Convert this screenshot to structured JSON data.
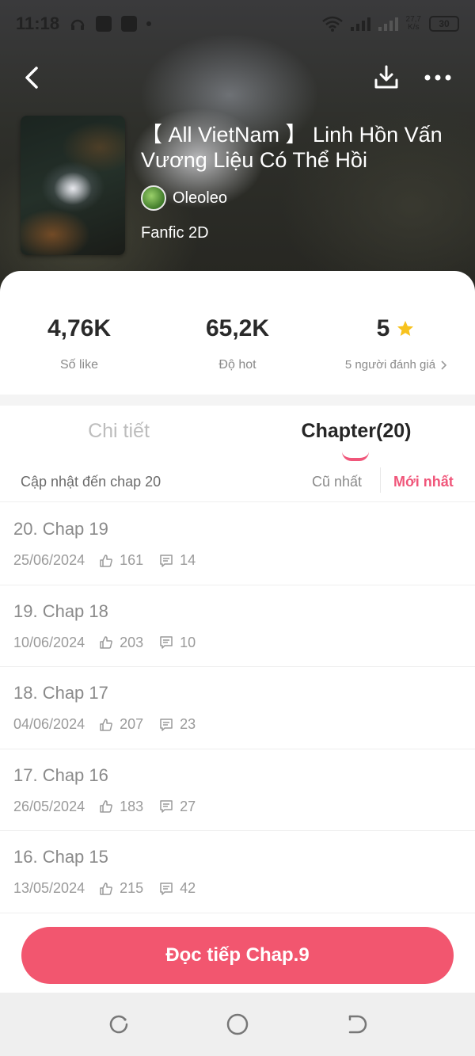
{
  "status_bar": {
    "time": "11:18",
    "net_speed": "27,7\nK/s",
    "battery": "30"
  },
  "header": {
    "back_icon": "chevron-left-icon",
    "download_icon": "download-icon",
    "more_icon": "more-horizontal-icon"
  },
  "book": {
    "title": "【 All VietNam 】 Linh Hồn Vấn Vương Liệu Có Thể Hồi",
    "author": "Oleoleo",
    "genre": "Fanfic 2D"
  },
  "stats": {
    "likes_value": "4,76K",
    "likes_label": "Số like",
    "hot_value": "65,2K",
    "hot_label": "Độ hot",
    "rating_value": "5",
    "rating_label": "5 người đánh giá",
    "star_color": "#f7c21e"
  },
  "tabs": {
    "detail": "Chi tiết",
    "chapter": "Chapter(20)"
  },
  "sort": {
    "update_text": "Cập nhật đến chap 20",
    "oldest": "Cũ nhất",
    "newest": "Mới nhất"
  },
  "chapters": [
    {
      "title": "20. Chap 19",
      "date": "25/06/2024",
      "likes": "161",
      "comments": "14"
    },
    {
      "title": "19. Chap 18",
      "date": "10/06/2024",
      "likes": "203",
      "comments": "10"
    },
    {
      "title": "18. Chap 17",
      "date": "04/06/2024",
      "likes": "207",
      "comments": "23"
    },
    {
      "title": "17. Chap 16",
      "date": "26/05/2024",
      "likes": "183",
      "comments": "27"
    },
    {
      "title": "16. Chap 15",
      "date": "13/05/2024",
      "likes": "215",
      "comments": "42"
    }
  ],
  "continue_button": "Đọc tiếp Chap.9",
  "accent_color": "#f2566f"
}
